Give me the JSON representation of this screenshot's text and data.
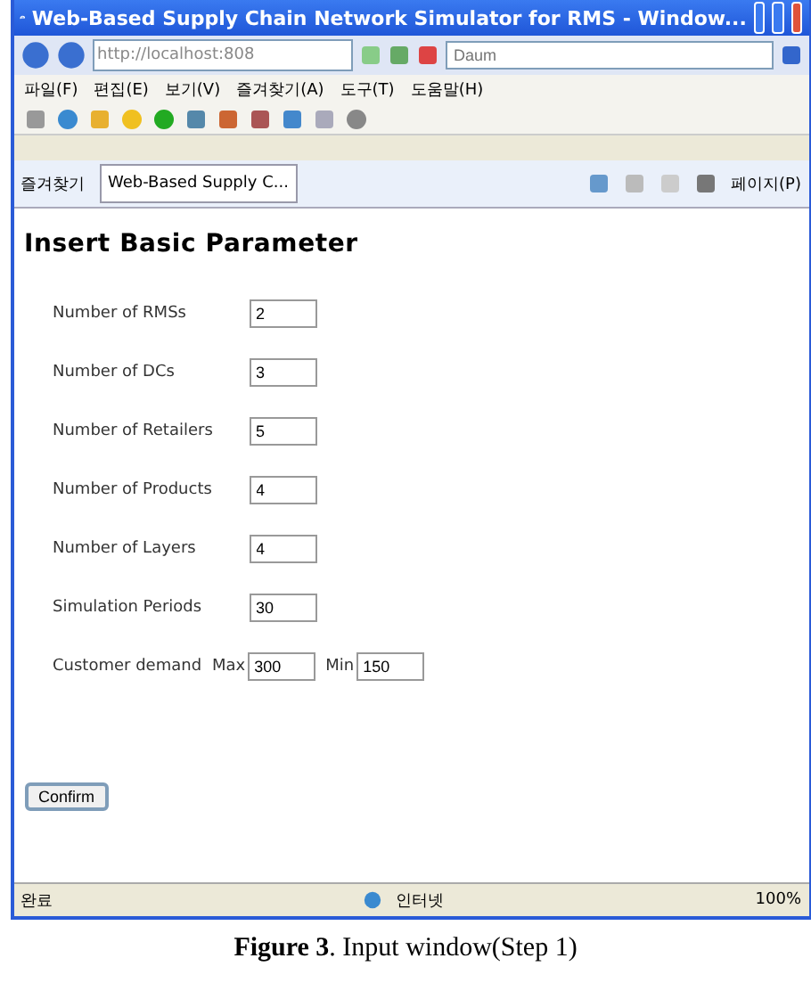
{
  "window": {
    "title": "Web-Based Supply Chain Network Simulator for RMS - Window..."
  },
  "address_bar": {
    "url": "http://localhost:808",
    "search_placeholder": "Daum"
  },
  "menu": [
    "파일(F)",
    "편집(E)",
    "보기(V)",
    "즐겨찾기(A)",
    "도구(T)",
    "도움말(H)"
  ],
  "tab_bar": {
    "favorites": "즐겨찾기",
    "tabs": [
      {
        "label": "Web-Based Supply C...",
        "selected": true
      }
    ],
    "page_menu": "페이지(P)"
  },
  "page": {
    "heading": "Insert Basic Parameter",
    "fields": [
      {
        "kind": "single",
        "label": "Number of RMSs",
        "value": "2"
      },
      {
        "kind": "single",
        "label": "Number of DCs",
        "value": "3"
      },
      {
        "kind": "single",
        "label": "Number of Retailers",
        "value": "5"
      },
      {
        "kind": "single",
        "label": "Number of Products",
        "value": "4"
      },
      {
        "kind": "single",
        "label": "Number of Layers",
        "value": "4"
      },
      {
        "kind": "single",
        "label": "Simulation Periods",
        "value": "30"
      },
      {
        "kind": "range",
        "label": "Customer demand",
        "max_label": "Max",
        "max": "300",
        "min_label": "Min",
        "min": "150"
      }
    ],
    "button": "Confirm"
  },
  "status_bar": {
    "status": "완료",
    "zone": "인터넷",
    "zoom": "100%"
  },
  "caption": "**Figure 3**. Input window(Step 1)"
}
